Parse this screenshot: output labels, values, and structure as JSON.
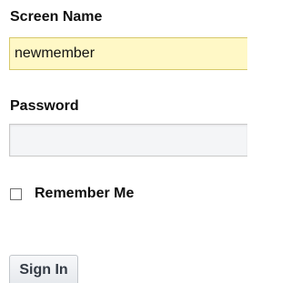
{
  "form": {
    "screen_name_label": "Screen Name",
    "screen_name_value": "newmember",
    "password_label": "Password",
    "password_value": "",
    "remember_label": "Remember Me",
    "remember_checked": false,
    "sign_in_label": "Sign In"
  },
  "colors": {
    "screen_name_bg": "#fff8c6",
    "password_bg": "#f4f5f7",
    "label_text": "#0f0f0f",
    "button_text": "#333a44"
  }
}
